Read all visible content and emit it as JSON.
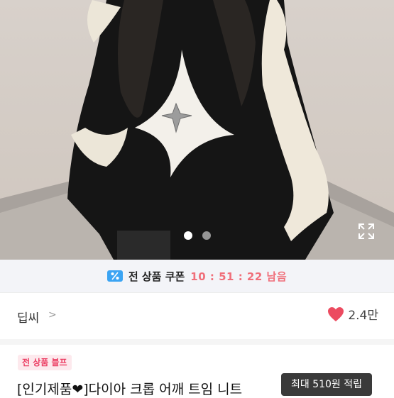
{
  "gallery": {
    "image_alt": "Dia crop shoulder open knit product photo",
    "page_dots": [
      "1",
      "2"
    ],
    "active_dot": 0,
    "expand_icon": "expand-icon"
  },
  "coupon": {
    "icon": "percent-coupon-icon",
    "icon_color": "#3ba4f3",
    "label": "전 상품 쿠폰",
    "timer": "10 : 51 : 22 남음",
    "timer_color": "#f06f7a"
  },
  "shop": {
    "name": "딥씨",
    "chevron": ">",
    "like_icon": "heart-icon",
    "like_color": "#ec4b60",
    "likes": "2.4만"
  },
  "product": {
    "tag": "전 상품 블프",
    "title": "[인기제품❤]다이아 크롭 어깨 트임 니트",
    "points_badge": "최대 510원 적립"
  }
}
